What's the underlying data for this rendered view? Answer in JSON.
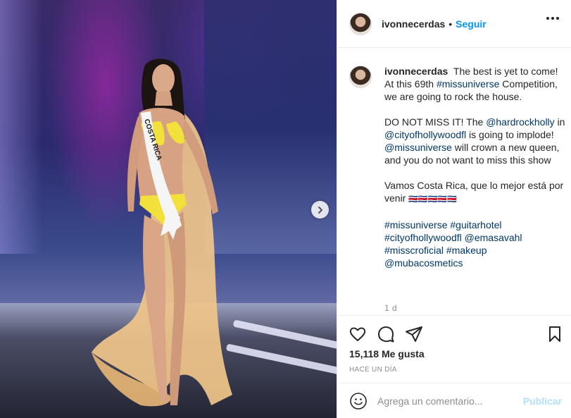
{
  "post": {
    "username": "ivonnecerdas",
    "follow_label": "Seguir",
    "separator": "•",
    "caption": {
      "p1_text": " The best is yet to come! At this 69th ",
      "p1_tag": "#missuniverse",
      "p1_tail": " Competition, we are going to rock the house.",
      "p2_a": "DO NOT MISS IT! The ",
      "p2_tag1": "@hardrockholly",
      "p2_b": " in ",
      "p2_tag2": "@cityofhollywoodfl",
      "p2_c": " is going to implode! ",
      "p2_tag3": "@missuniverse",
      "p2_d": " will crown a new queen, and you do not want to miss this show",
      "p3_text": "Vamos Costa Rica, que lo mejor está por venir ",
      "p3_flags": "🇨🇷🇨🇷🇨🇷🇨🇷🇨🇷",
      "hashtags": [
        "#missuniverse",
        "#guitarhotel",
        "#cityofhollywoodfl",
        "@emasavahl",
        "#misscroficial",
        "#makeup",
        "@mubacosmetics"
      ]
    },
    "caption_age": "1 d",
    "likes": "15,118 Me gusta",
    "posted": "HACE UN DÍA",
    "comment_placeholder": "Agrega un comentario...",
    "publish_label": "Publicar"
  },
  "photo": {
    "sash_text": "COSTA RICA"
  },
  "icons": {
    "like": "heart-icon",
    "comment": "comment-icon",
    "share": "paper-plane-icon",
    "save": "bookmark-icon",
    "next": "chevron-right-icon",
    "emoji": "smiley-icon",
    "more": "more-options-icon"
  },
  "colors": {
    "link": "#00376b",
    "follow": "#0095f6",
    "publish_disabled": "#b2dffc",
    "muted": "#8e8e8e"
  }
}
